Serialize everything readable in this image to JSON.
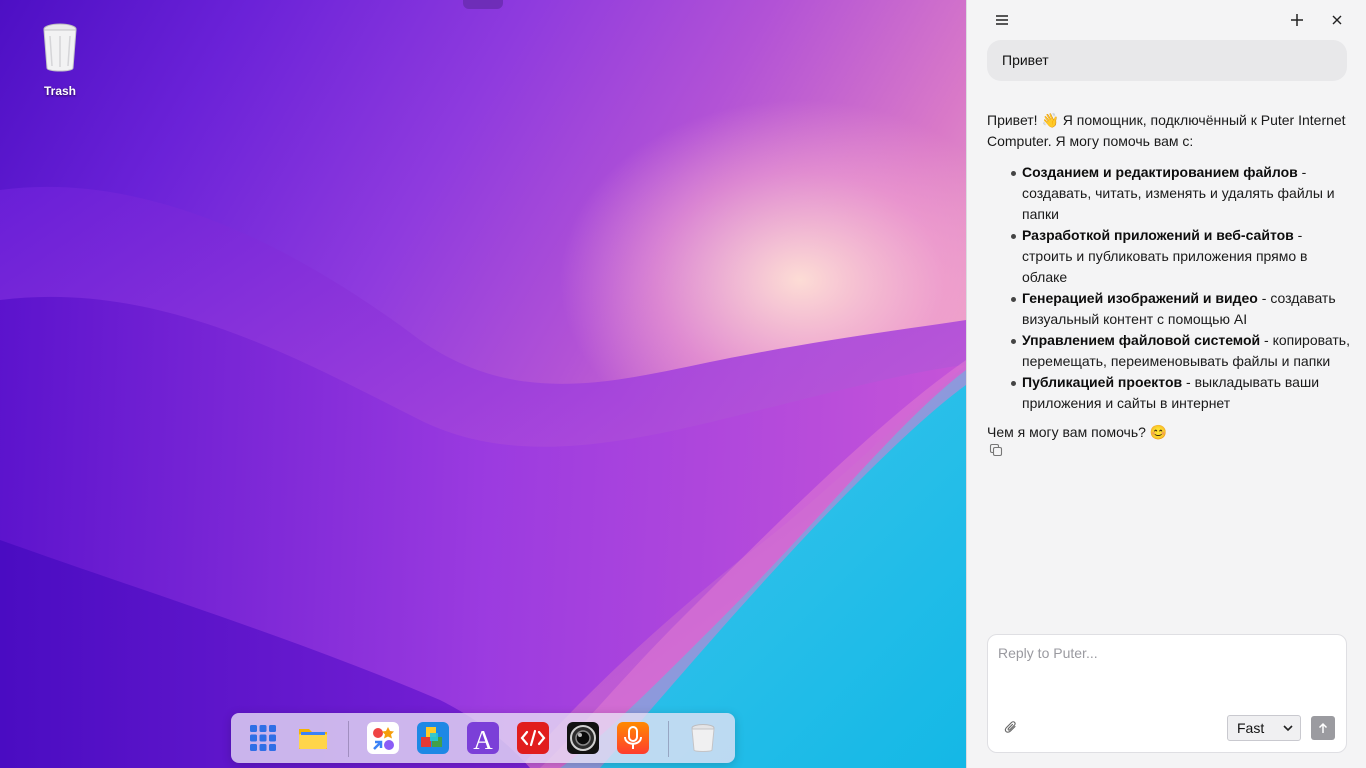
{
  "desktop": {
    "icons": [
      {
        "label": "Trash",
        "icon": "trash-icon"
      }
    ]
  },
  "dock": {
    "items": [
      {
        "name": "app-launcher",
        "icon": "grid-icon"
      },
      {
        "name": "files",
        "icon": "folder-icon"
      },
      {
        "name": "app-center",
        "icon": "apps-icon"
      },
      {
        "name": "cubes",
        "icon": "cubes-icon"
      },
      {
        "name": "editor",
        "icon": "letter-a-icon"
      },
      {
        "name": "code",
        "icon": "code-icon"
      },
      {
        "name": "camera",
        "icon": "camera-icon"
      },
      {
        "name": "recorder",
        "icon": "microphone-icon"
      },
      {
        "name": "trash",
        "icon": "trash-icon"
      }
    ]
  },
  "chat": {
    "header": {
      "menu_icon": "menu-icon",
      "new_icon": "plus-icon",
      "close_icon": "close-icon"
    },
    "user_message": "Привет",
    "assistant": {
      "intro": "Привет! 👋 Я помощник, подключённый к Puter Internet Computer. Я могу помочь вам с:",
      "items": [
        {
          "bold": "Созданием и редактированием файлов",
          "rest": " - создавать, читать, изменять и удалять файлы и папки"
        },
        {
          "bold": "Разработкой приложений и веб-сайтов",
          "rest": " - строить и публиковать приложения прямо в облаке"
        },
        {
          "bold": "Генерацией изображений и видео",
          "rest": " - создавать визуальный контент с помощью AI"
        },
        {
          "bold": "Управлением файловой системой",
          "rest": " - копировать, перемещать, переименовывать файлы и папки"
        },
        {
          "bold": "Публикацией проектов",
          "rest": " - выкладывать ваши приложения и сайты в интернет"
        }
      ],
      "outro": "Чем я могу вам помочь? 😊"
    },
    "composer": {
      "placeholder": "Reply to Puter...",
      "value": "",
      "model": "Fast",
      "attach_icon": "paperclip-icon",
      "send_icon": "arrow-up-icon"
    }
  },
  "colors": {
    "panel_bg": "#f4f4f5",
    "bubble_bg": "#e8e8ea",
    "send_bg": "#9b9ba0"
  }
}
